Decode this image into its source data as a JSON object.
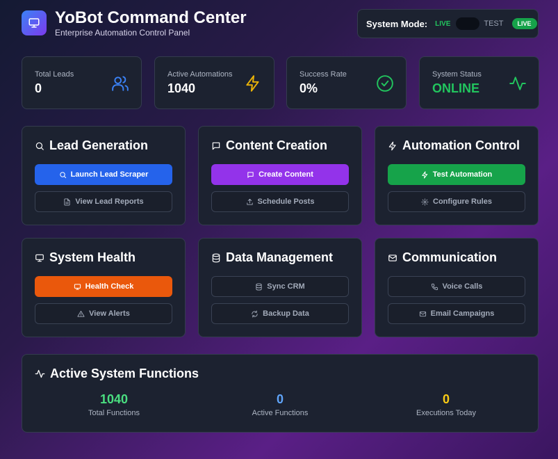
{
  "header": {
    "title": "YoBot Command Center",
    "subtitle": "Enterprise Automation Control Panel",
    "logo_icon": "monitor-icon"
  },
  "system_mode": {
    "label": "System Mode:",
    "live": "LIVE",
    "test": "TEST",
    "badge": "LIVE"
  },
  "stats": [
    {
      "label": "Total Leads",
      "value": "0",
      "icon": "users-icon",
      "color": "#3b82f6"
    },
    {
      "label": "Active Automations",
      "value": "1040",
      "icon": "lightning-icon",
      "color": "#eab308"
    },
    {
      "label": "Success Rate",
      "value": "0%",
      "icon": "check-circle-icon",
      "color": "#22c55e"
    },
    {
      "label": "System Status",
      "value": "ONLINE",
      "icon": "activity-icon",
      "color": "#22c55e"
    }
  ],
  "modules": [
    {
      "title": "Lead Generation",
      "icon": "search-icon",
      "primary": "Launch Lead Scraper",
      "primary_color": "#2563eb",
      "secondary": "View Lead Reports"
    },
    {
      "title": "Content Creation",
      "icon": "message-icon",
      "primary": "Create Content",
      "primary_color": "#9333ea",
      "secondary": "Schedule Posts"
    },
    {
      "title": "Automation Control",
      "icon": "lightning-icon",
      "primary": "Test Automation",
      "primary_color": "#16a34a",
      "secondary": "Configure Rules"
    },
    {
      "title": "System Health",
      "icon": "monitor-icon",
      "primary": "Health Check",
      "primary_color": "#ea580c",
      "secondary": "View Alerts"
    },
    {
      "title": "Data Management",
      "icon": "database-icon",
      "primary": "Sync CRM",
      "secondary": "Backup Data"
    },
    {
      "title": "Communication",
      "icon": "mail-icon",
      "primary": "Voice Calls",
      "secondary": "Email Campaigns"
    }
  ],
  "functions": {
    "title": "Active System Functions",
    "stats": [
      {
        "value": "1040",
        "label": "Total Functions",
        "color": "#4ade80"
      },
      {
        "value": "0",
        "label": "Active Functions",
        "color": "#60a5fa"
      },
      {
        "value": "0",
        "label": "Executions Today",
        "color": "#facc15"
      }
    ]
  }
}
